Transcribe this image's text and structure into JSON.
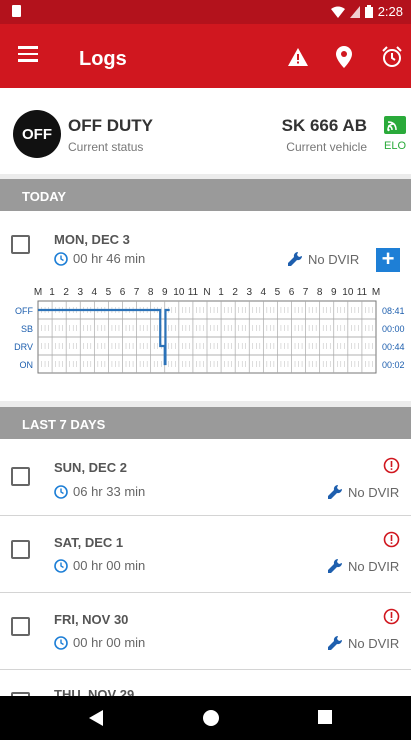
{
  "status_bar": {
    "time": "2:28"
  },
  "app_bar": {
    "title": "Logs"
  },
  "status_card": {
    "badge": "OFF",
    "duty_status": "OFF DUTY",
    "duty_sub": "Current status",
    "vehicle": "SK 666 AB",
    "vehicle_sub": "Current vehicle",
    "elo_label": "ELO"
  },
  "today_section": {
    "title": "TODAY"
  },
  "today": {
    "date": "MON, DEC 3",
    "duration": "00 hr  46 min",
    "dvir": "No DVIR",
    "add_label": "+",
    "grid": {
      "hour_labels": [
        "M",
        "1",
        "2",
        "3",
        "4",
        "5",
        "6",
        "7",
        "8",
        "9",
        "10",
        "11",
        "N",
        "1",
        "2",
        "3",
        "4",
        "5",
        "6",
        "7",
        "8",
        "9",
        "10",
        "11",
        "M"
      ],
      "row_labels": [
        "OFF",
        "SB",
        "DRV",
        "ON"
      ],
      "totals": [
        "08:41",
        "00:00",
        "00:44",
        "00:02"
      ],
      "line_color": "#2b72b8"
    }
  },
  "last7_section": {
    "title": "LAST 7 DAYS"
  },
  "days": [
    {
      "date": "SUN, DEC 2",
      "duration": "06 hr  33 min",
      "dvir": "No DVIR"
    },
    {
      "date": "SAT, DEC 1",
      "duration": "00 hr  00 min",
      "dvir": "No DVIR"
    },
    {
      "date": "FRI, NOV 30",
      "duration": "00 hr  00 min",
      "dvir": "No DVIR"
    },
    {
      "date": "THU, NOV 29"
    }
  ],
  "colors": {
    "brand_red": "#d0171f",
    "accent_blue": "#1e7fd6",
    "alert_red": "#d0171f",
    "elo_green": "#2aaa3a"
  }
}
